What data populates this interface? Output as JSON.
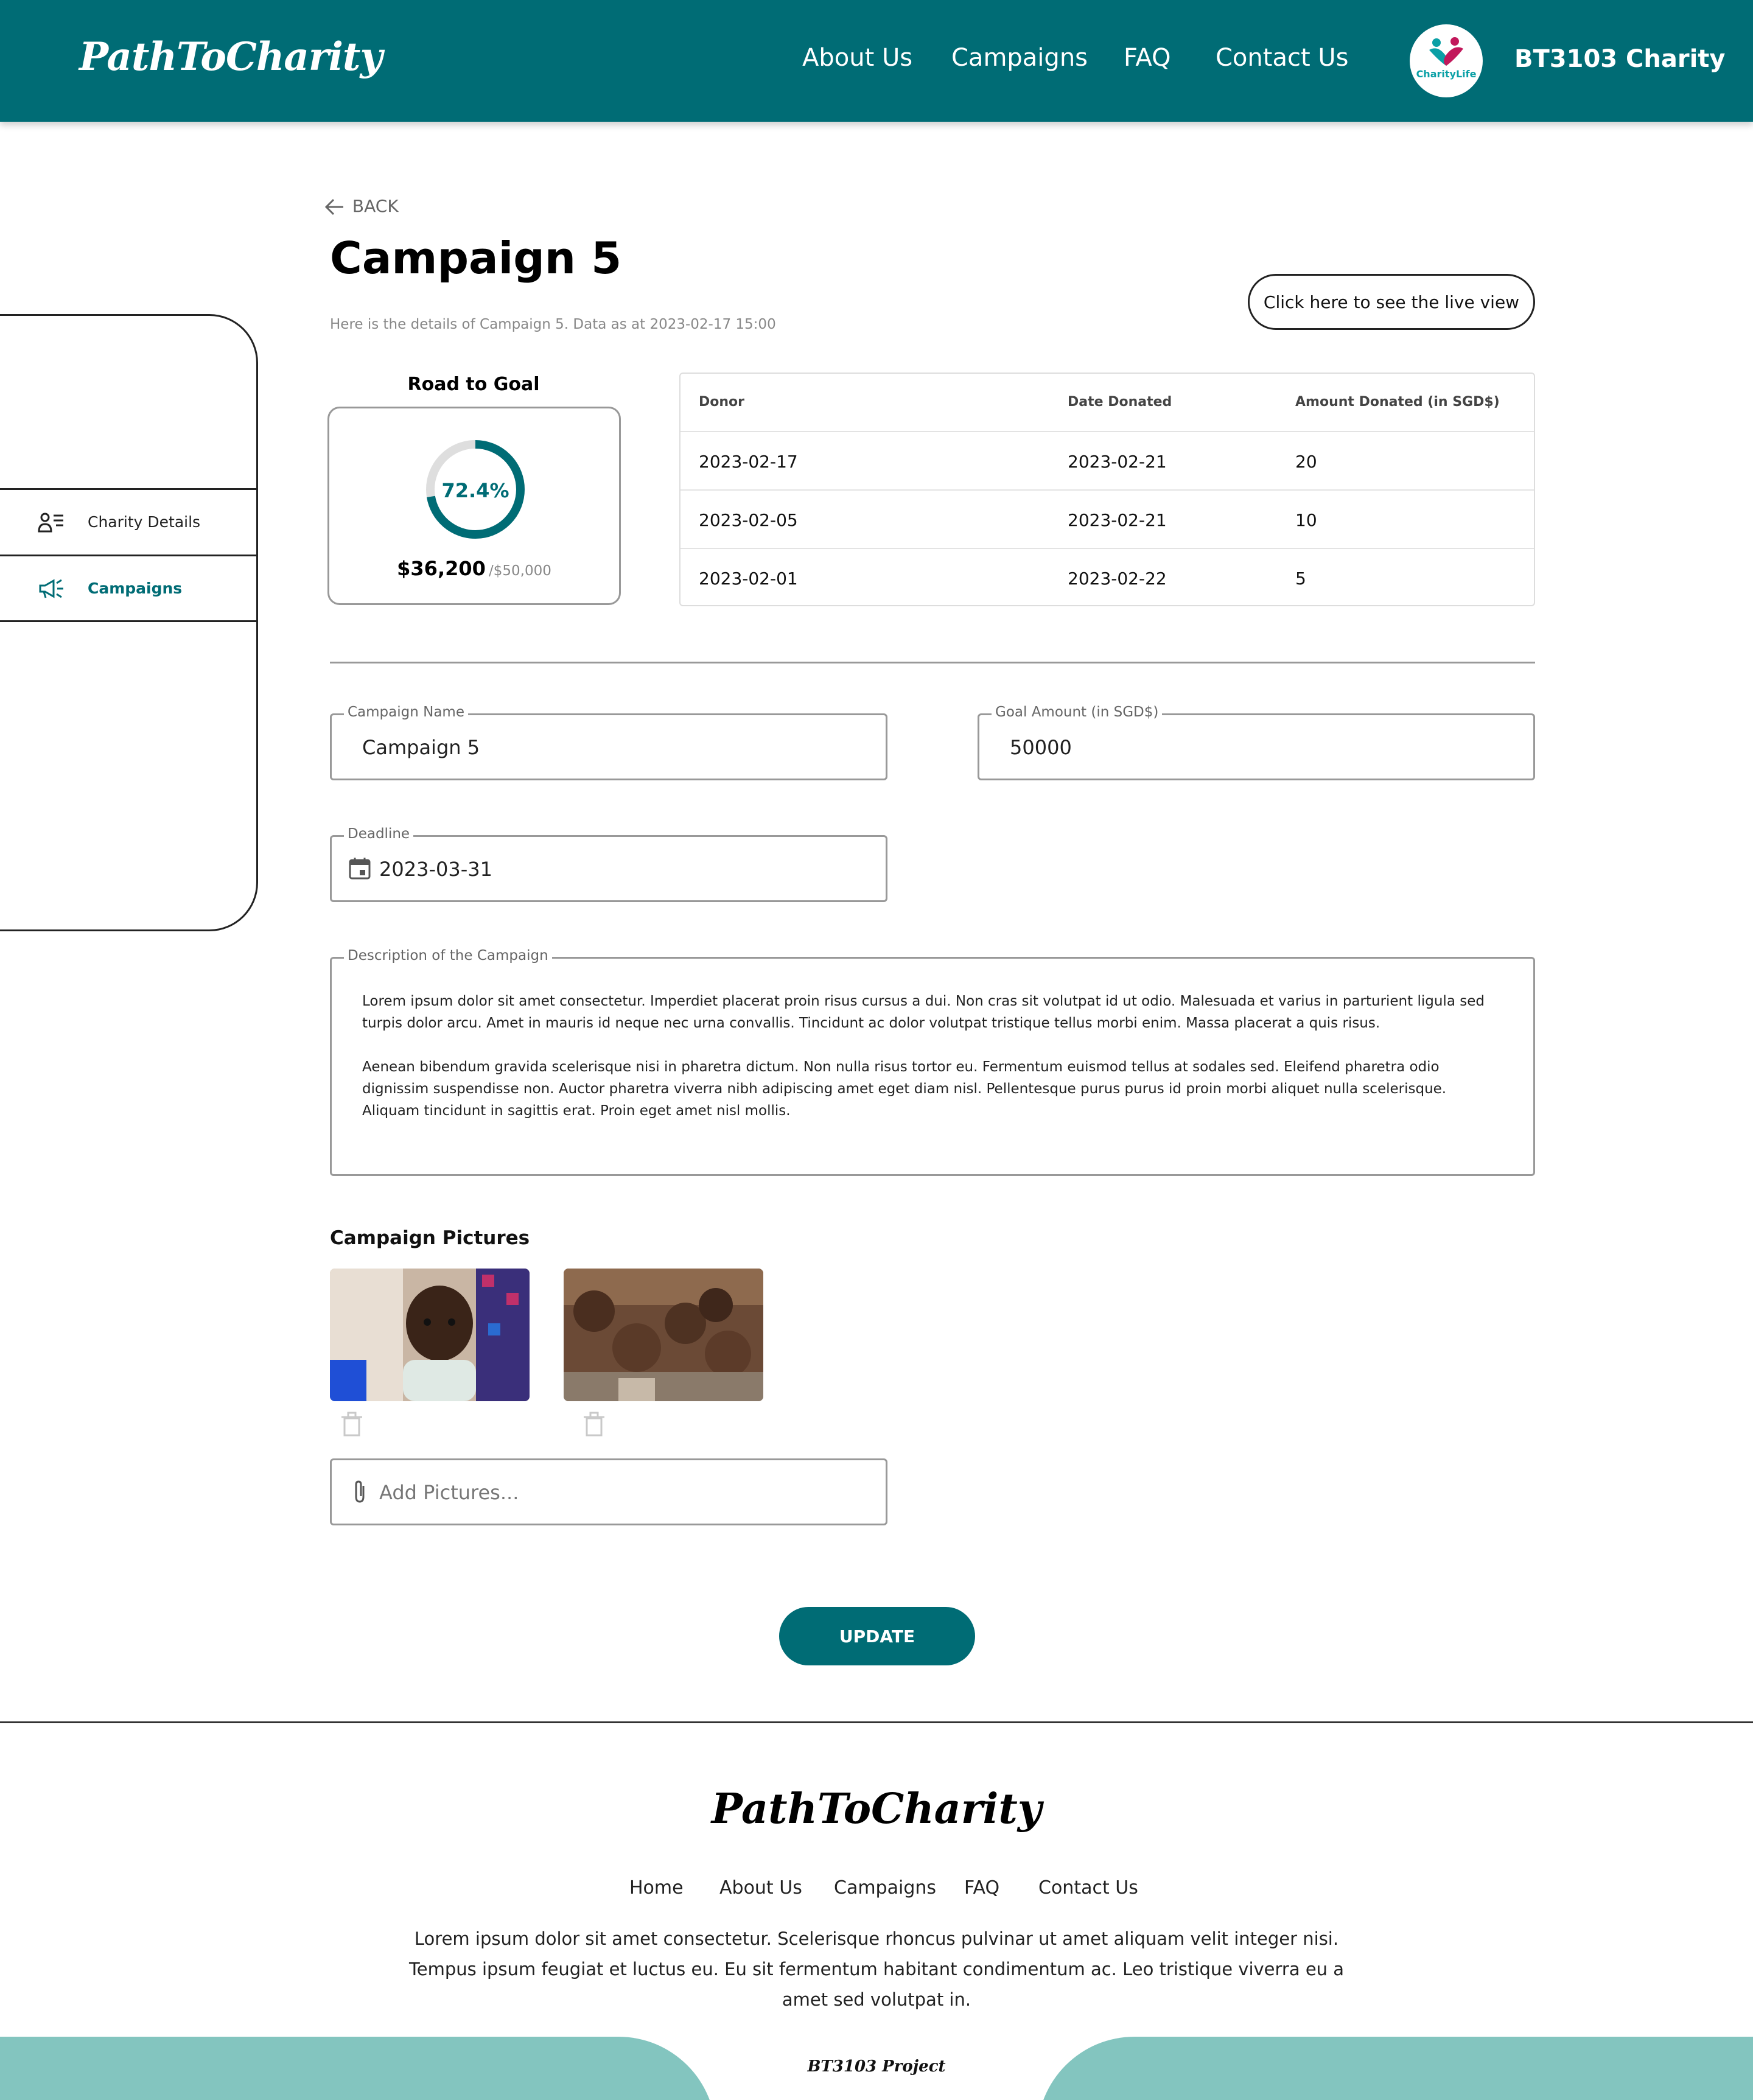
{
  "header": {
    "logo": "PathToCharity",
    "nav": [
      "About Us",
      "Campaigns",
      "FAQ",
      "Contact Us"
    ],
    "avatar_text": "CharityLife",
    "org_name": "BT3103 Charity",
    "bg_color": "#006c75"
  },
  "sidebar": {
    "items": [
      {
        "label": "Charity Details",
        "icon": "user-list-icon",
        "active": false
      },
      {
        "label": "Campaigns",
        "icon": "megaphone-icon",
        "active": true
      }
    ]
  },
  "main": {
    "back_label": "BACK",
    "title": "Campaign 5",
    "subtitle": "Here is the details of Campaign 5. Data as at 2023-02-17 15:00",
    "live_view_label": "Click here to see the live view"
  },
  "goal": {
    "title": "Road to Goal",
    "percent_label": "72.4%",
    "progress_fraction": 0.724,
    "raised": "$36,200",
    "goal": "/$50,000"
  },
  "donations": {
    "columns": [
      "Donor",
      "Date Donated",
      "Amount Donated (in SGD$)"
    ],
    "rows": [
      [
        "2023-02-17",
        "2023-02-21",
        "20"
      ],
      [
        "2023-02-05",
        "2023-02-21",
        "10"
      ],
      [
        "2023-02-01",
        "2023-02-22",
        "5"
      ]
    ]
  },
  "form": {
    "campaign_name_label": "Campaign Name",
    "campaign_name_value": "Campaign 5",
    "goal_amount_label": "Goal Amount (in SGD$)",
    "goal_amount_value": "50000",
    "deadline_label": "Deadline",
    "deadline_value": "2023-03-31",
    "description_label": "Description of the Campaign",
    "description_p1": "Lorem ipsum dolor sit amet consectetur. Imperdiet placerat proin risus cursus a dui. Non cras sit volutpat id ut odio. Malesuada et varius in parturient ligula sed turpis dolor arcu. Amet in mauris id neque nec urna convallis. Tincidunt ac dolor volutpat tristique tellus morbi enim. Massa placerat a quis risus.",
    "description_p2": "Aenean bibendum gravida scelerisque nisi in pharetra dictum. Non nulla risus tortor eu. Fermentum euismod tellus at sodales sed. Eleifend pharetra odio dignissim suspendisse non. Auctor pharetra viverra nibh adipiscing amet eget diam nisl. Pellentesque purus purus id proin morbi aliquet nulla scelerisque. Aliquam tincidunt in sagittis erat. Proin eget amet nisl mollis.",
    "pictures_title": "Campaign Pictures",
    "add_pictures_placeholder": "Add Pictures...",
    "update_label": "UPDATE"
  },
  "footer": {
    "logo": "PathToCharity",
    "nav": [
      "Home",
      "About Us",
      "Campaigns",
      "FAQ",
      "Contact Us"
    ],
    "text": "Lorem ipsum dolor sit amet consectetur. Scelerisque rhoncus pulvinar ut amet aliquam velit integer nisi. Tempus ipsum feugiat et luctus eu. Eu sit fermentum habitant condimentum ac. Leo tristique viverra eu a amet sed volutpat in.",
    "band_text": "BT3103 Project",
    "band_color": "#83c5bf"
  }
}
